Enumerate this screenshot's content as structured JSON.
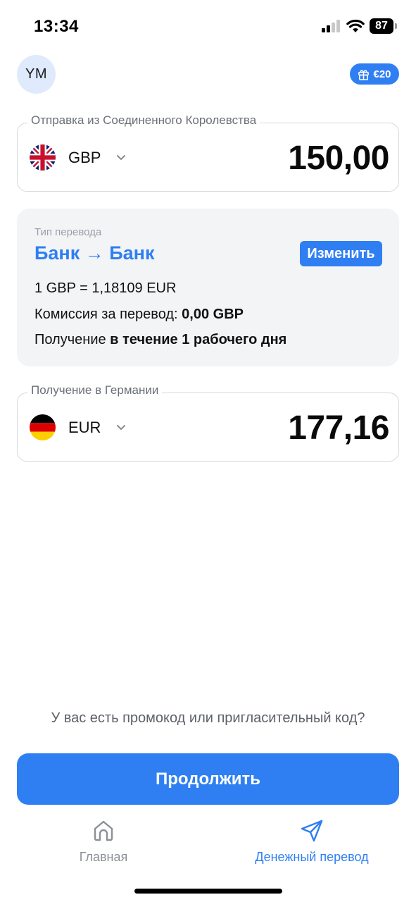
{
  "status_bar": {
    "time": "13:34",
    "battery_level": "87",
    "icons": [
      "signal-icon",
      "wifi-icon",
      "battery-icon"
    ]
  },
  "header": {
    "avatar_initials": "YM",
    "gift_badge_label": "€20",
    "gift_icon": "gift-icon"
  },
  "send": {
    "label": "Отправка из Соединенного Королевства",
    "currency": "GBP",
    "amount": "150,00",
    "flag_icon": "uk-flag-icon"
  },
  "transfer_info": {
    "caption": "Тип перевода",
    "title": "Банк → Банк",
    "change_label": "Изменить",
    "rate": "1 GBP = 1,18109 EUR",
    "fee_label": "Комиссия за перевод: ",
    "fee_value": "0,00 GBP",
    "delivery_label": "Получение ",
    "delivery_value": "в течение 1 рабочего дня"
  },
  "receive": {
    "label": "Получение в Германии",
    "currency": "EUR",
    "amount": "177,16",
    "flag_icon": "germany-flag-icon"
  },
  "promo_link": "У вас есть промокод или пригласительный код?",
  "continue_label": "Продолжить",
  "tab_bar": {
    "items": [
      {
        "label": "Главная",
        "icon": "home-icon",
        "active": false
      },
      {
        "label": "Денежный перевод",
        "icon": "send-icon",
        "active": true
      }
    ]
  },
  "colors": {
    "accent": "#2f7ff3",
    "card_background": "#f3f4f6",
    "avatar_background": "#dfeafc",
    "inactive_tab": "#8c9097"
  }
}
